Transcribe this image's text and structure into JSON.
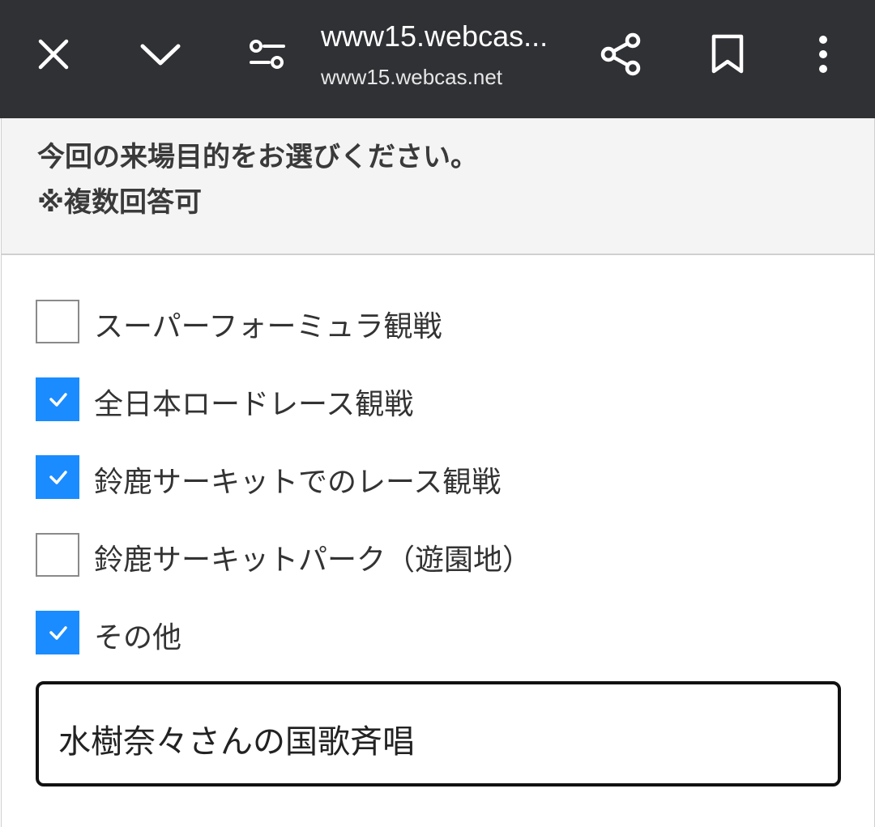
{
  "toolbar": {
    "page_title": "www15.webcas...",
    "url": "www15.webcas.net",
    "icons": [
      "close-icon",
      "chevron-down-icon",
      "tune-icon",
      "share-icon",
      "bookmark-icon",
      "more-vert-icon"
    ]
  },
  "question": {
    "line1": "今回の来場目的をお選びください。",
    "line2": "※複数回答可"
  },
  "options": [
    {
      "label": "スーパーフォーミュラ観戦",
      "checked": false
    },
    {
      "label": "全日本ロードレース観戦",
      "checked": true
    },
    {
      "label": "鈴鹿サーキットでのレース観戦",
      "checked": true
    },
    {
      "label": "鈴鹿サーキットパーク（遊園地）",
      "checked": false
    },
    {
      "label": "その他",
      "checked": true
    }
  ],
  "other_input": {
    "value": "水樹奈々さんの国歌斉唱"
  },
  "colors": {
    "toolbar": "#303135",
    "checkbox_checked": "#1a8cff",
    "question_bg": "#f4f4f4"
  }
}
